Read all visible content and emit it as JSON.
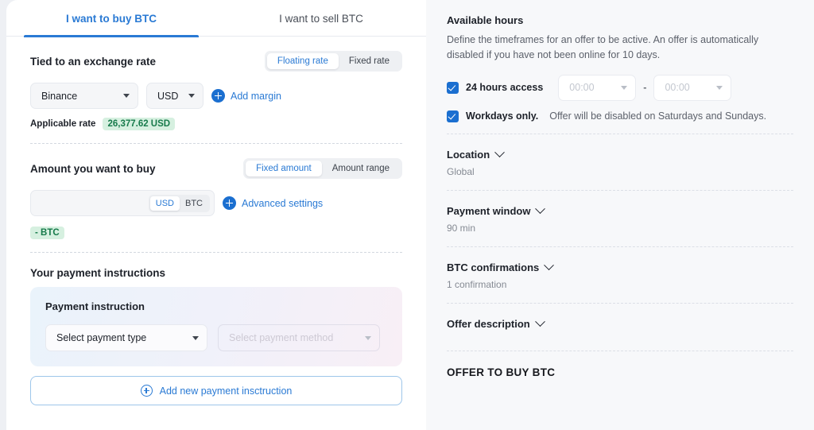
{
  "tabs": [
    {
      "label": "I want to buy BTC",
      "active": true
    },
    {
      "label": "I want to sell BTC",
      "active": false
    }
  ],
  "exchange_rate": {
    "title": "Tied to an exchange rate",
    "segmented": {
      "options": [
        "Floating rate",
        "Fixed rate"
      ],
      "selected": "Floating rate"
    },
    "exchange_select": "Binance",
    "currency_select": "USD",
    "add_margin_label": "Add margin",
    "applicable_rate_label": "Applicable rate",
    "applicable_rate_value": "26,377.62 USD"
  },
  "amount": {
    "title": "Amount you want to buy",
    "segmented": {
      "options": [
        "Fixed amount",
        "Amount range"
      ],
      "selected": "Fixed amount"
    },
    "input_value": "",
    "input_placeholder": "",
    "currency_toggle": {
      "options": [
        "USD",
        "BTC"
      ],
      "selected": "USD"
    },
    "advanced_settings_label": "Advanced settings",
    "btc_chip": "- BTC"
  },
  "payment_instructions": {
    "title": "Your payment instructions",
    "card_title": "Payment instruction",
    "payment_type_select": "Select payment type",
    "payment_method_select": "Select payment method",
    "add_button_label": "Add new payment insctruction"
  },
  "available_hours": {
    "title": "Available hours",
    "description": "Define the timeframes for an offer to be active. An offer is automatically disabled if you have not been online for 10 days.",
    "checkbox_24h_label": "24 hours access",
    "checkbox_24h_checked": true,
    "time_from": "00:00",
    "time_to": "00:00",
    "time_separator": "-",
    "checkbox_workdays_label": "Workdays only.",
    "checkbox_workdays_note": "Offer will be disabled on Saturdays and Sundays.",
    "checkbox_workdays_checked": true
  },
  "collapsibles": [
    {
      "title": "Location",
      "value": "Global"
    },
    {
      "title": "Payment window",
      "value": "90 min"
    },
    {
      "title": "BTC confirmations",
      "value": "1 confirmation"
    },
    {
      "title": "Offer description",
      "value": ""
    }
  ],
  "footer": {
    "offer_title": "OFFER TO BUY BTC"
  },
  "colors": {
    "accent_blue": "#2a7ad4",
    "plus_blue": "#1b6fd0",
    "chip_green_text": "#167a4a",
    "chip_green_bg": "#d6f0e0",
    "panel_bg": "#f7f8fa",
    "page_bg": "#eef0f4"
  }
}
